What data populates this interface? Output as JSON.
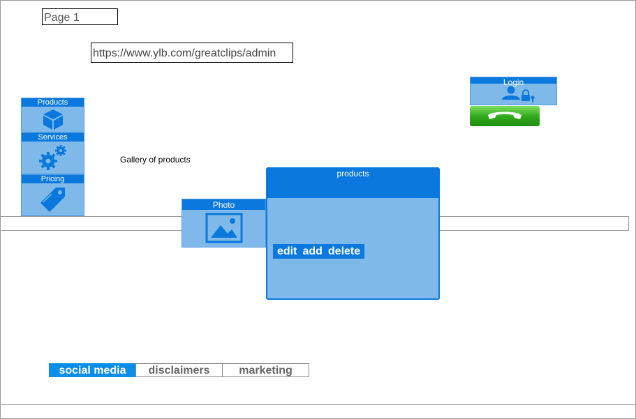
{
  "page": {
    "label": "Page 1"
  },
  "url": "https://www.ylb.com/greatclips/admin",
  "sidebar": {
    "items": [
      {
        "label": "Products",
        "icon": "cube-icon"
      },
      {
        "label": "Services",
        "icon": "gears-icon"
      },
      {
        "label": "Pricing",
        "icon": "price-tag-icon"
      }
    ]
  },
  "gallery": {
    "label": "Gallery of products"
  },
  "photo": {
    "label": "Photo",
    "icon": "image-icon"
  },
  "products_panel": {
    "title": "products",
    "actions": [
      "edit",
      "add",
      "delete"
    ]
  },
  "login": {
    "label": "Login",
    "icon": "user-lock-icon"
  },
  "call": {
    "icon": "phone-icon"
  },
  "footer_tabs": [
    {
      "label": "social media",
      "active": true
    },
    {
      "label": "disclaimers",
      "active": false
    },
    {
      "label": "marketing",
      "active": false
    }
  ],
  "colors": {
    "accent": "#0a78dc",
    "tile_fill": "#7fb9ea",
    "call_green": "#2fa81a"
  }
}
